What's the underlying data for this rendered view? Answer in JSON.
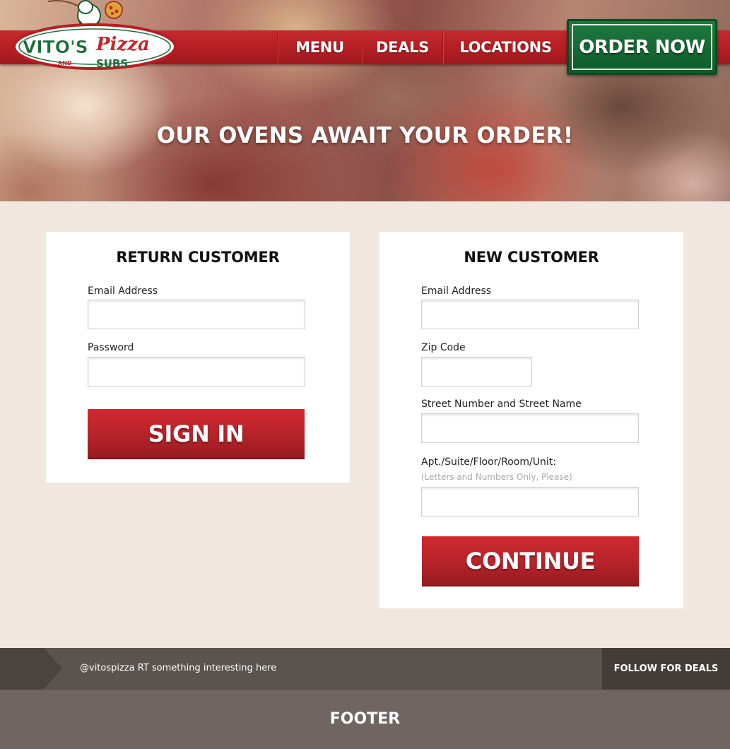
{
  "brand": {
    "logo_main": "VITO'S",
    "logo_script": "Pizza",
    "logo_and": "AND",
    "logo_subs": "SUBS",
    "colors": {
      "red": "#b51f24",
      "green": "#1a6e37",
      "cream": "#f0e8df"
    }
  },
  "nav": {
    "items": [
      {
        "label": "MENU"
      },
      {
        "label": "DEALS"
      },
      {
        "label": "LOCATIONS"
      }
    ],
    "order_now": "ORDER NOW"
  },
  "hero": {
    "title": "OUR OVENS AWAIT YOUR ORDER!"
  },
  "return_customer": {
    "title": "RETURN CUSTOMER",
    "email_label": "Email Address",
    "email_value": "",
    "password_label": "Password",
    "password_value": "",
    "submit": "SIGN IN"
  },
  "new_customer": {
    "title": "NEW CUSTOMER",
    "email_label": "Email Address",
    "email_value": "",
    "zip_label": "Zip Code",
    "zip_value": "",
    "street_label": "Street Number and Street Name",
    "street_value": "",
    "apt_label": "Apt./Suite/Floor/Room/Unit:",
    "apt_hint": "(Letters and Numbers Only, Please)",
    "apt_value": "",
    "submit": "CONTINUE"
  },
  "twitter": {
    "text": "@vitospizza RT something interesting here",
    "follow": "FOLLOW FOR DEALS"
  },
  "footer": {
    "title": "FOOTER"
  }
}
